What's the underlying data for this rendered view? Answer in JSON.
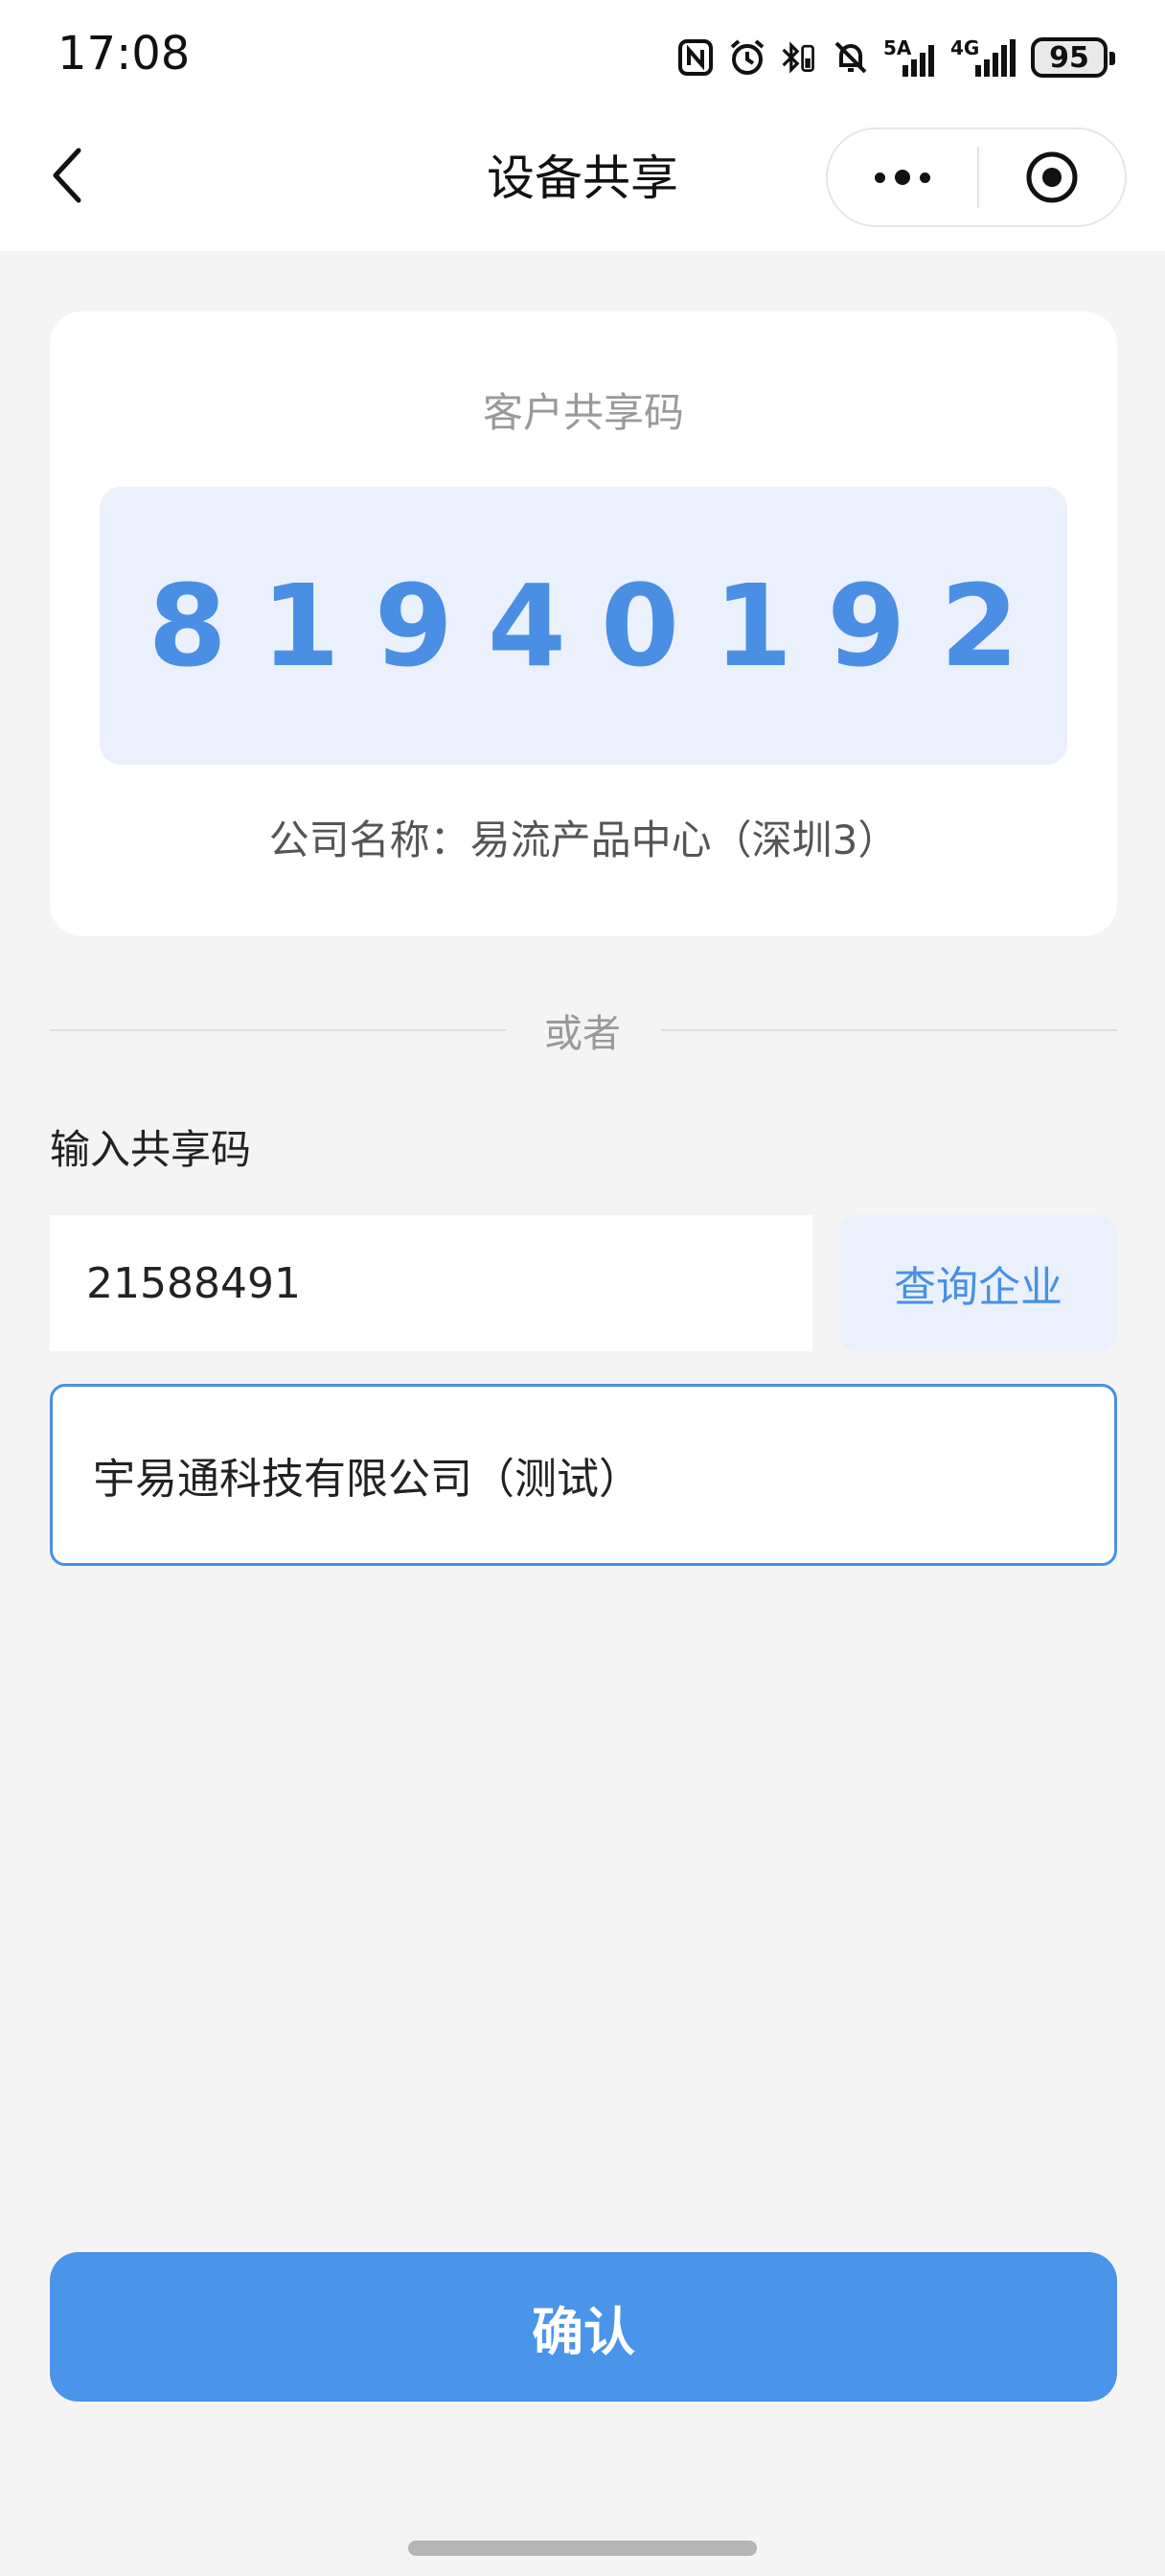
{
  "status_bar": {
    "time": "17:08",
    "icons": [
      "nfc-icon",
      "alarm-icon",
      "bluetooth-icon",
      "mute-icon",
      "5g-signal-icon",
      "4g-signal-icon"
    ],
    "net_5g": "5A",
    "net_4g": "4G",
    "battery": "95"
  },
  "header": {
    "title": "设备共享",
    "back_icon": "back-arrow-icon",
    "more_icon": "more-dots-icon",
    "close_icon": "target-close-icon"
  },
  "share_card": {
    "title": "客户共享码",
    "code": "81940192",
    "company_line": "公司名称：易流产品中心（深圳3）"
  },
  "divider": {
    "text": "或者"
  },
  "input_section": {
    "label": "输入共享码",
    "input_value": "21588491",
    "query_button": "查询企业",
    "result_company": "宇易通科技有限公司（测试）"
  },
  "confirm_button": "确认",
  "colors": {
    "accent": "#4a94ea",
    "accent_text": "#4a8fe3",
    "accent_light_bg": "#eaf1fc",
    "page_bg": "#f4f4f5"
  }
}
